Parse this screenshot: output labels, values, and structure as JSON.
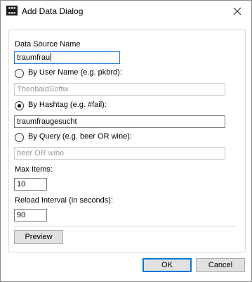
{
  "window": {
    "title": "Add Data Dialog",
    "icon_name": "app-logo-icon",
    "close_icon": "close-icon"
  },
  "form": {
    "data_source_name_label": "Data Source Name",
    "data_source_name_value": "traumfrau",
    "by_user_name_label": "By User Name (e.g. pkbrd):",
    "by_user_name_value": "TheobaldSoftw",
    "by_user_name_selected": false,
    "by_hashtag_label": "By Hashtag (e.g. #fail):",
    "by_hashtag_value": "traumfraugesucht",
    "by_hashtag_selected": true,
    "by_query_label": "By Query (e.g. beer OR wine):",
    "by_query_value": "beer OR wine",
    "by_query_selected": false,
    "max_items_label": "Max Items:",
    "max_items_value": "10",
    "reload_interval_label": "Reload Interval (in seconds):",
    "reload_interval_value": "90",
    "preview_label": "Preview"
  },
  "footer": {
    "ok_label": "OK",
    "cancel_label": "Cancel"
  },
  "colors": {
    "focus_border": "#1e7ad6",
    "default_button_border": "#0078d7",
    "button_face": "#e1e1e1",
    "disabled_text": "#9a9a9a"
  }
}
